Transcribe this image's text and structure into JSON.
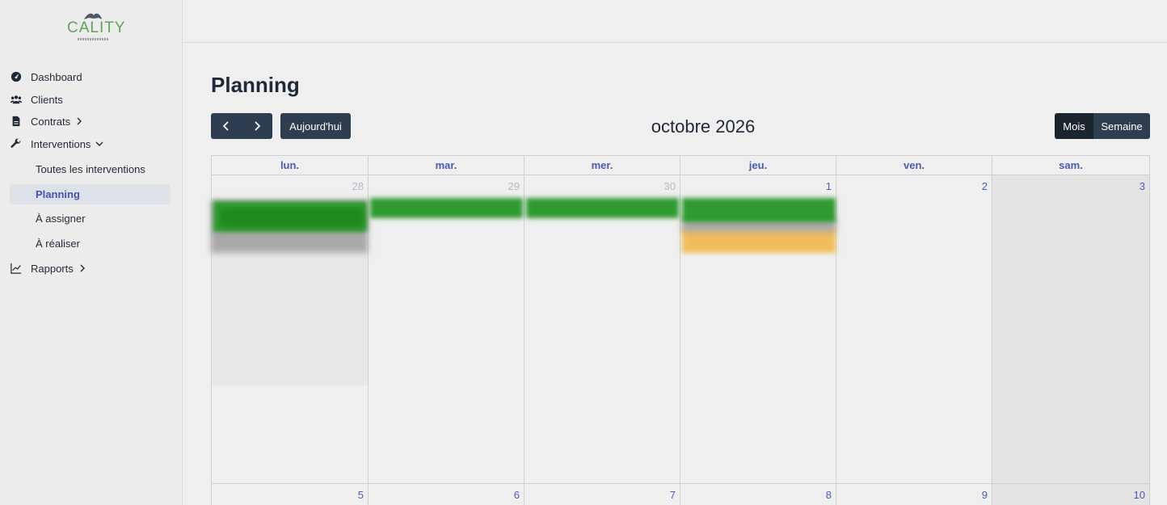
{
  "app": {
    "logo_text": "CALITY"
  },
  "sidebar": {
    "items": [
      {
        "label": "Dashboard",
        "icon": "gauge-icon"
      },
      {
        "label": "Clients",
        "icon": "users-icon"
      },
      {
        "label": "Contrats",
        "icon": "document-icon",
        "expandable": true
      },
      {
        "label": "Interventions",
        "icon": "wrench-icon",
        "expanded": true
      },
      {
        "label": "Rapports",
        "icon": "chart-line-icon",
        "expandable": true
      }
    ],
    "sub_items": [
      {
        "label": "Toutes les interventions",
        "active": false
      },
      {
        "label": "Planning",
        "active": true
      },
      {
        "label": "À assigner",
        "active": false
      },
      {
        "label": "À réaliser",
        "active": false
      }
    ]
  },
  "page": {
    "title": "Planning"
  },
  "toolbar": {
    "today_label": "Aujourd'hui",
    "month_title": "octobre 2026",
    "views": [
      "Mois",
      "Semaine"
    ],
    "active_view": "Mois"
  },
  "calendar": {
    "weekdays": [
      "lun.",
      "mar.",
      "mer.",
      "jeu.",
      "ven.",
      "sam."
    ],
    "week1": [
      "28",
      "29",
      "30",
      "1",
      "2",
      "3"
    ],
    "week2": [
      "5",
      "6",
      "7",
      "8",
      "9",
      "10"
    ]
  },
  "colors": {
    "accent": "#4a5bb5",
    "button_dark": "#2c3e50",
    "event_green": "#2f9a2f",
    "event_orange": "#efbd5b",
    "event_gray": "#a8a8a8"
  }
}
